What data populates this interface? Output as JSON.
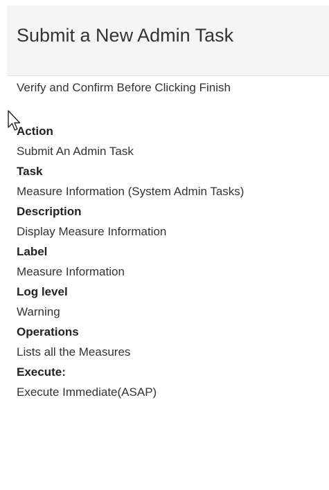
{
  "header": {
    "title": "Submit a New Admin Task"
  },
  "subtitle": "Verify and Confirm Before Clicking Finish",
  "fields": [
    {
      "label": "Action",
      "value": "Submit An Admin Task"
    },
    {
      "label": "Task",
      "value": "Measure Information (System Admin Tasks)"
    },
    {
      "label": "Description",
      "value": "Display Measure Information"
    },
    {
      "label": "Label",
      "value": "Measure Information"
    },
    {
      "label": "Log level",
      "value": "Warning"
    },
    {
      "label": "Operations",
      "value": "Lists all the Measures"
    },
    {
      "label": "Execute:",
      "value": "Execute Immediate(ASAP)"
    }
  ],
  "icons": {
    "cursor": "mouse-pointer-icon"
  }
}
